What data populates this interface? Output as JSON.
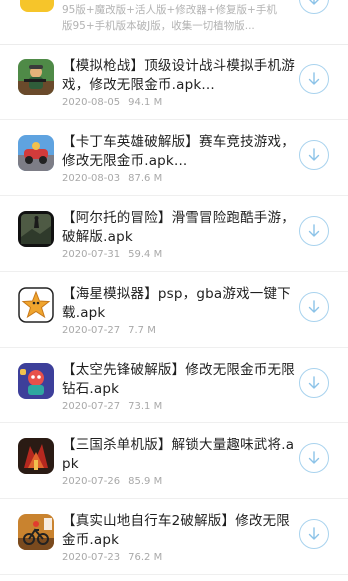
{
  "top_item": {
    "desc_line1": "95版+魔改版+活人版+修改器+修复版+手机",
    "desc_line2": "版95+手机版本破J版，收集一切植物版..."
  },
  "items": [
    {
      "title": "【模拟枪战】顶级设计战斗模拟手机游戏，修改无限金币.apk...",
      "date": "2020-08-05",
      "size": "94.1 M",
      "icon": "gun-game-icon"
    },
    {
      "title": "【卡丁车英雄破解版】赛车竞技游戏，修改无限金币.apk...",
      "date": "2020-08-03",
      "size": "87.6 M",
      "icon": "kart-game-icon"
    },
    {
      "title": "【阿尔托的冒险】滑雪冒险跑酷手游，破解版.apk",
      "date": "2020-07-31",
      "size": "59.4 M",
      "icon": "alto-game-icon"
    },
    {
      "title": "【海星模拟器】psp，gba游戏一键下载.apk",
      "date": "2020-07-27",
      "size": "7.7 M",
      "icon": "starfish-emulator-icon"
    },
    {
      "title": "【太空先锋破解版】修改无限金币无限钻石.apk",
      "date": "2020-07-27",
      "size": "73.1 M",
      "icon": "space-game-icon"
    },
    {
      "title": "【三国杀单机版】解锁大量趣味武将.apk",
      "date": "2020-07-26",
      "size": "85.9 M",
      "icon": "three-kingdoms-game-icon"
    },
    {
      "title": "【真实山地自行车2破解版】修改无限金币.apk",
      "date": "2020-07-23",
      "size": "76.2 M",
      "icon": "bike-game-icon"
    }
  ],
  "colors": {
    "download_ring": "#a9d3ee",
    "download_arrow": "#8cc3e8",
    "meta_text": "#a8a8a8"
  }
}
